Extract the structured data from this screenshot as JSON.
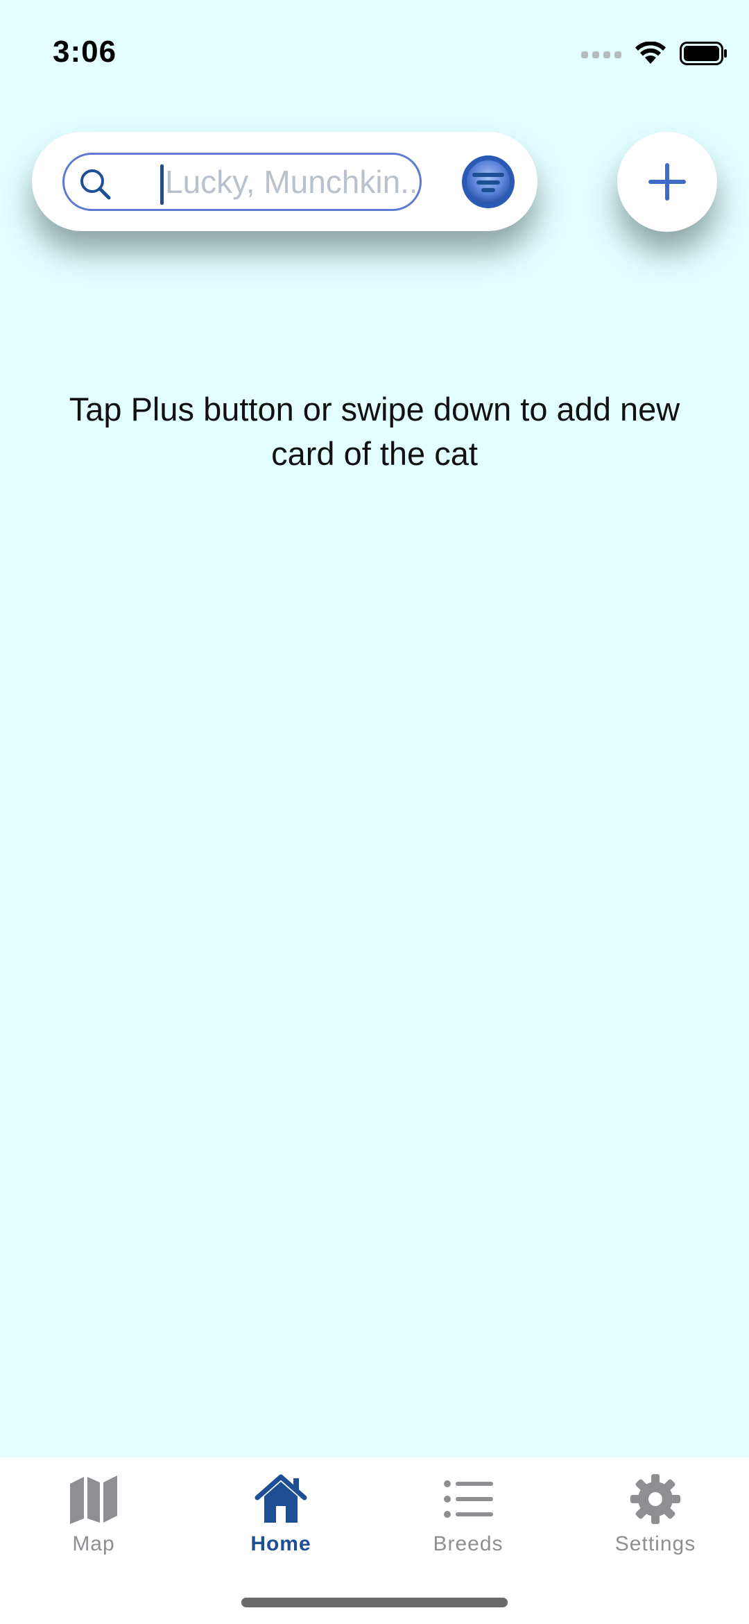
{
  "status_bar": {
    "time": "3:06",
    "icons": [
      "cellular-signal-icon",
      "wifi-icon",
      "battery-icon"
    ]
  },
  "search": {
    "placeholder": "Lucky, Munchkin...",
    "value": ""
  },
  "icons": {
    "search": "search-icon",
    "filter": "filter-icon",
    "add": "plus-icon"
  },
  "main": {
    "empty_message": "Tap Plus button or swipe down to add new card of the cat"
  },
  "tab_bar": {
    "tabs": [
      {
        "label": "Map",
        "icon": "map-icon",
        "active": false
      },
      {
        "label": "Home",
        "icon": "house-icon",
        "active": true
      },
      {
        "label": "Breeds",
        "icon": "list-icon",
        "active": false
      },
      {
        "label": "Settings",
        "icon": "gear-icon",
        "active": false
      }
    ]
  },
  "colors": {
    "background": "#e3fefe",
    "accent": "#1e4f95",
    "accent_light": "#5d7bd0",
    "inactive": "#8e8e93"
  }
}
